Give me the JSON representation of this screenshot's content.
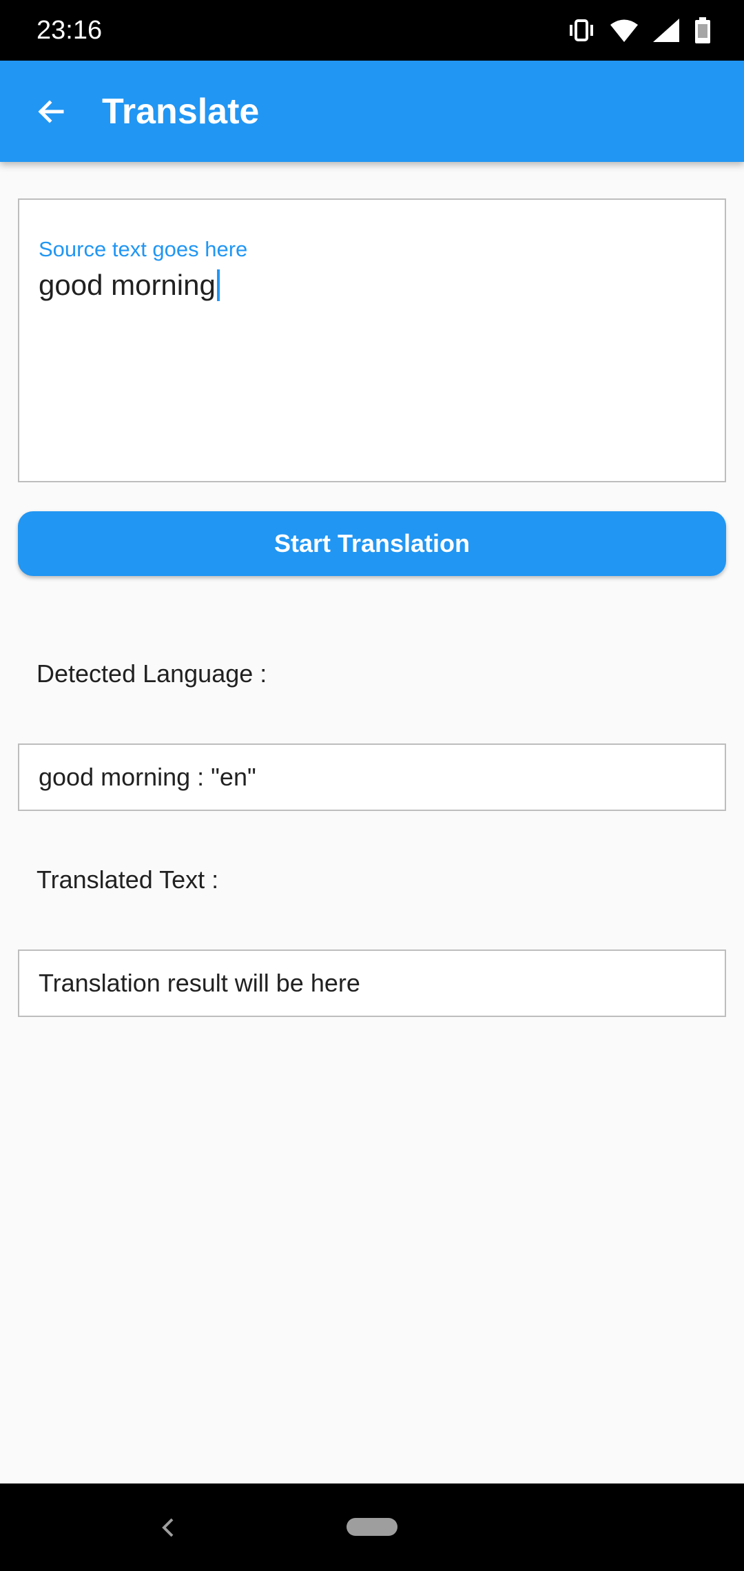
{
  "status_bar": {
    "time": "23:16",
    "icons": [
      "vibrate-icon",
      "wifi-icon",
      "signal-icon",
      "battery-icon"
    ]
  },
  "app_bar": {
    "back_icon": "arrow-back-icon",
    "title": "Translate",
    "color": "#2196f3"
  },
  "source": {
    "label": "Source text goes here",
    "value": "good morning"
  },
  "translate_button": {
    "label": "Start Translation"
  },
  "detected": {
    "label": "Detected Language :",
    "value": "good morning : \"en\""
  },
  "translated": {
    "label": "Translated Text :",
    "value": "Translation result will be here"
  },
  "nav_bar": {
    "icons": [
      "nav-back-icon",
      "home-pill-icon"
    ]
  }
}
